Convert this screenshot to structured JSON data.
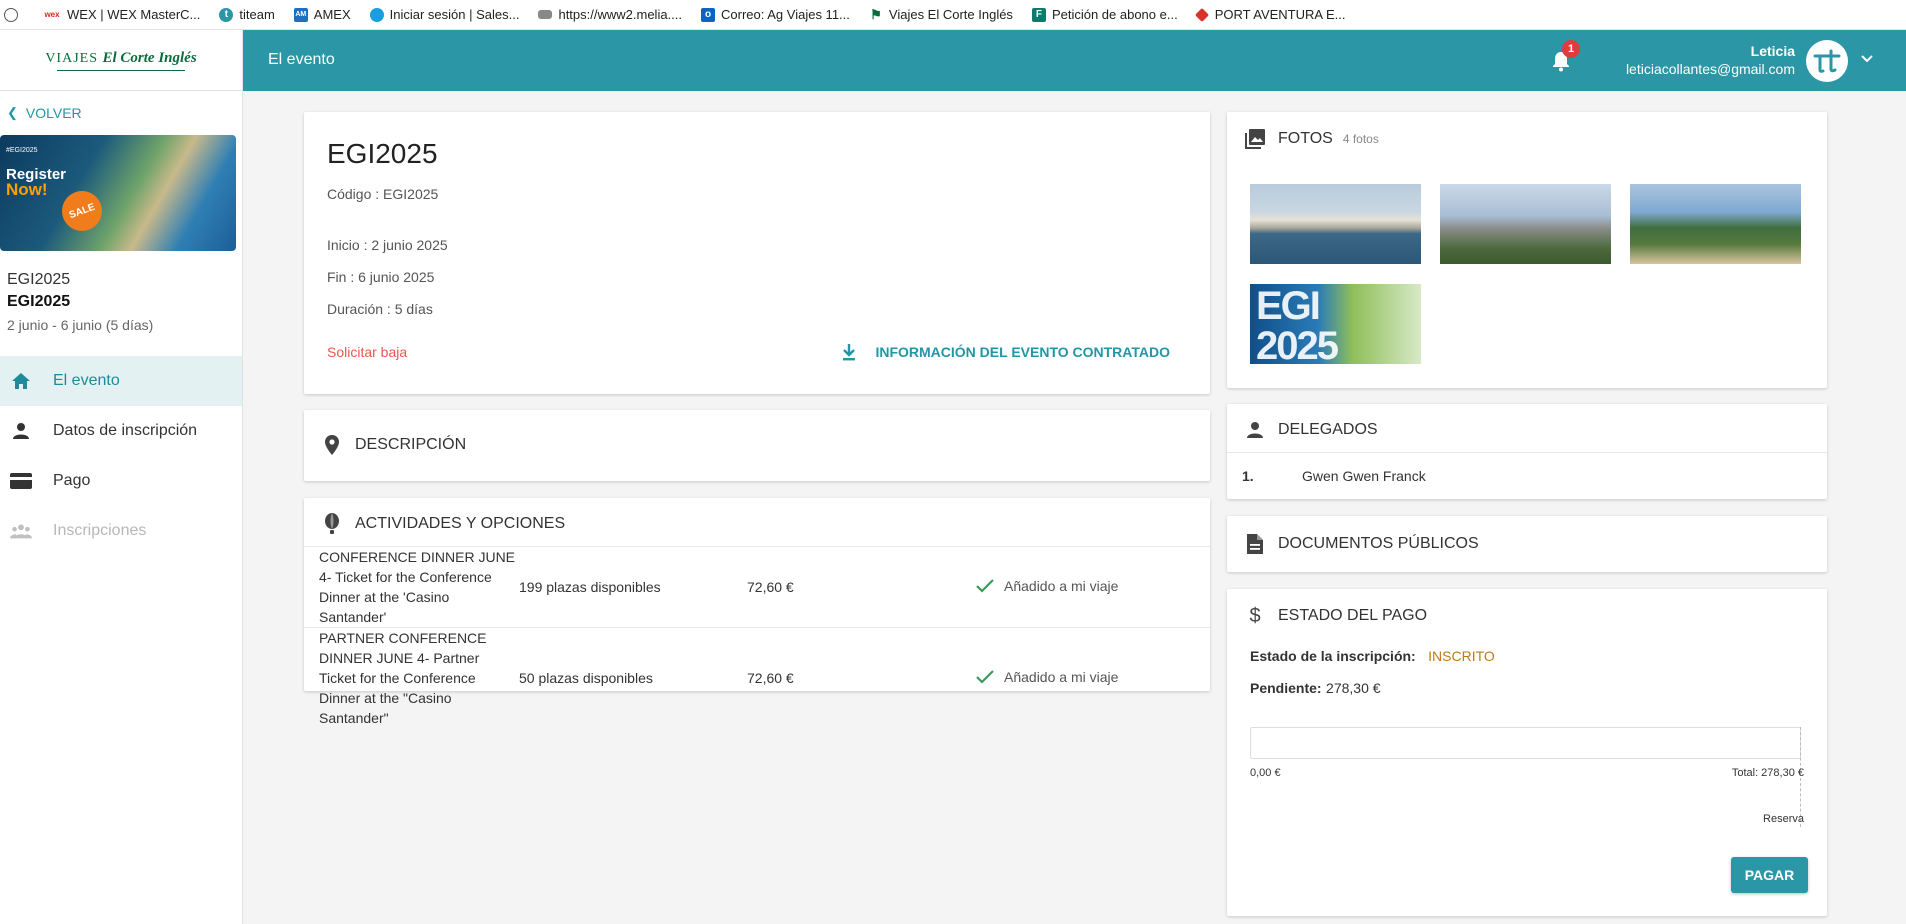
{
  "bookmarks": [
    {
      "label": "",
      "icon": "globe-icon"
    },
    {
      "label": "WEX | WEX MasterC...",
      "icon": "wex-icon"
    },
    {
      "label": "titeam",
      "icon": "titeam-icon"
    },
    {
      "label": "AMEX",
      "icon": "amex-icon"
    },
    {
      "label": "Iniciar sesión | Sales...",
      "icon": "salesforce-icon"
    },
    {
      "label": "https://www2.melia....",
      "icon": "melia-icon"
    },
    {
      "label": "Correo: Ag Viajes 11...",
      "icon": "outlook-icon"
    },
    {
      "label": "Viajes El Corte Inglés",
      "icon": "eci-icon"
    },
    {
      "label": "Petición de abono e...",
      "icon": "forms-icon"
    },
    {
      "label": "PORT AVENTURA E...",
      "icon": "portaventura-icon"
    }
  ],
  "colors": {
    "primary": "#2b96a6",
    "accent_text": "#2196a6",
    "danger": "#e35a4d",
    "status": "#c07a14",
    "badge": "#e23b3b"
  },
  "logo": {
    "text_a": "VIAJES",
    "text_b": "El Corte Inglés"
  },
  "sidebar": {
    "back_label": "VOLVER",
    "banner": {
      "tiny": "#EGI2025",
      "line1": "Register",
      "line2": "Now!",
      "sale": "SALE"
    },
    "event_name": "EGI2025",
    "event_name_bold": "EGI2025",
    "event_dates": "2 junio - 6 junio (5 días)",
    "nav": [
      {
        "label": "El evento",
        "icon": "home-icon",
        "state": "active"
      },
      {
        "label": "Datos de inscripción",
        "icon": "person-icon",
        "state": "normal"
      },
      {
        "label": "Pago",
        "icon": "credit-card-icon",
        "state": "normal"
      },
      {
        "label": "Inscripciones",
        "icon": "group-icon",
        "state": "disabled"
      }
    ]
  },
  "header": {
    "title": "El evento",
    "notifications": "1",
    "user_name": "Leticia",
    "user_email": "leticiacollantes@gmail.com"
  },
  "event": {
    "title": "EGI2025",
    "code": "Código : EGI2025",
    "start": "Inicio : 2 junio 2025",
    "end": "Fin : 6 junio 2025",
    "duration": "Duración : 5 días",
    "cancel_label": "Solicitar baja",
    "info_label": "INFORMACIÓN DEL EVENTO CONTRATADO"
  },
  "description": {
    "title": "DESCRIPCIÓN"
  },
  "activities": {
    "title": "ACTIVIDADES Y OPCIONES",
    "rows": [
      {
        "name": "CONFERENCE DINNER JUNE 4- Ticket for the Conference Dinner at the 'Casino Santander'",
        "places": "199 plazas disponibles",
        "price": "72,60 €",
        "status": "Añadido a mi viaje"
      },
      {
        "name": "PARTNER CONFERENCE DINNER JUNE 4- Partner Ticket for the Conference Dinner at the \"Casino Santander\"",
        "places": "50 plazas disponibles",
        "price": "72,60 €",
        "status": "Añadido a mi viaje"
      }
    ]
  },
  "photos": {
    "title": "FOTOS",
    "count": "4 fotos",
    "egi_text_1": "EGI",
    "egi_text_2": "2025"
  },
  "delegates": {
    "title": "DELEGADOS",
    "items": [
      {
        "num": "1.",
        "name": "Gwen Gwen Franck"
      }
    ]
  },
  "public_docs": {
    "title": "DOCUMENTOS PÚBLICOS"
  },
  "payment": {
    "title": "ESTADO DEL PAGO",
    "status_label": "Estado de la inscripción:",
    "status_value": "INSCRITO",
    "pending_label": "Pendiente:",
    "pending_value": "278,30 €",
    "paid": "0,00 €",
    "total": "Total: 278,30 €",
    "reserve_label": "Reserva",
    "paid_fraction": 0,
    "pay_button": "PAGAR"
  }
}
